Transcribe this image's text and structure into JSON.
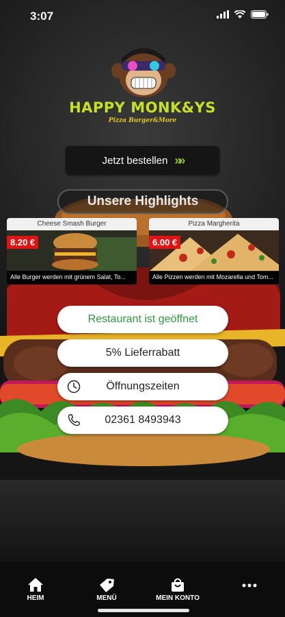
{
  "status_bar": {
    "time": "3:07"
  },
  "brand": {
    "name": "HAPPY MONK&YS",
    "tagline": "Pizza Burger&More"
  },
  "order_button": {
    "label": "Jetzt bestellen",
    "arrows": "»»"
  },
  "highlights": {
    "title": "Unsere Highlights",
    "items": [
      {
        "name": "Cheese Smash Burger",
        "price": "8.20 €",
        "description": "Alle Burger werden mit grünem Salat, To..."
      },
      {
        "name": "Pizza Margherita",
        "price": "6.00 €",
        "description": "Alle Pizzen werden mit Mozarella und Tom..."
      }
    ]
  },
  "info": {
    "status": "Restaurant ist geöffnet",
    "discount": "5% Lieferrabatt",
    "hours": "Öffnungszeiten",
    "phone": "02361 8493943"
  },
  "tabs": [
    {
      "label": "HEIM",
      "icon": "home-icon"
    },
    {
      "label": "MENÜ",
      "icon": "tag-icon"
    },
    {
      "label": "MEIN KONTO",
      "icon": "bag-icon"
    },
    {
      "label": "",
      "icon": "more-icon"
    }
  ],
  "colors": {
    "brand": "#c6e024",
    "accent_green": "#8fbf2a",
    "price_red": "#e01414",
    "open_green": "#2c9a3c"
  }
}
